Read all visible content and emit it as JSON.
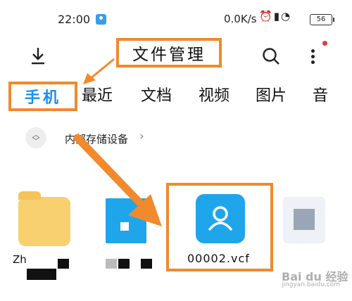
{
  "status_bar": {
    "time": "22:00",
    "network_speed": "0.0K/s",
    "battery": "56",
    "icons": [
      "app-badge-icon",
      "alarm-icon",
      "signal-icon",
      "wifi-icon",
      "battery-icon"
    ]
  },
  "toolbar": {
    "title": "文件管理",
    "icons": [
      "download-icon",
      "search-icon",
      "more-icon"
    ]
  },
  "tabs": [
    {
      "label": "手机",
      "active": true
    },
    {
      "label": "最近"
    },
    {
      "label": "文档"
    },
    {
      "label": "视频"
    },
    {
      "label": "图片"
    },
    {
      "label": "音"
    }
  ],
  "breadcrumb": {
    "path": "内部存储设备",
    "chevron": "›"
  },
  "files": [
    {
      "name": "Zh",
      "type": "folder"
    },
    {
      "name": "",
      "type": "image"
    },
    {
      "name": "00002.vcf",
      "type": "vcf"
    },
    {
      "name": "",
      "type": "image"
    }
  ],
  "watermark": {
    "main": "Bai du 经验",
    "sub": "jingyan.baidu.com"
  },
  "colors": {
    "accent": "#1a8ff0",
    "annotation": "#f08a2c",
    "folder": "#f8d06f",
    "file_blue": "#1fa5ea"
  }
}
